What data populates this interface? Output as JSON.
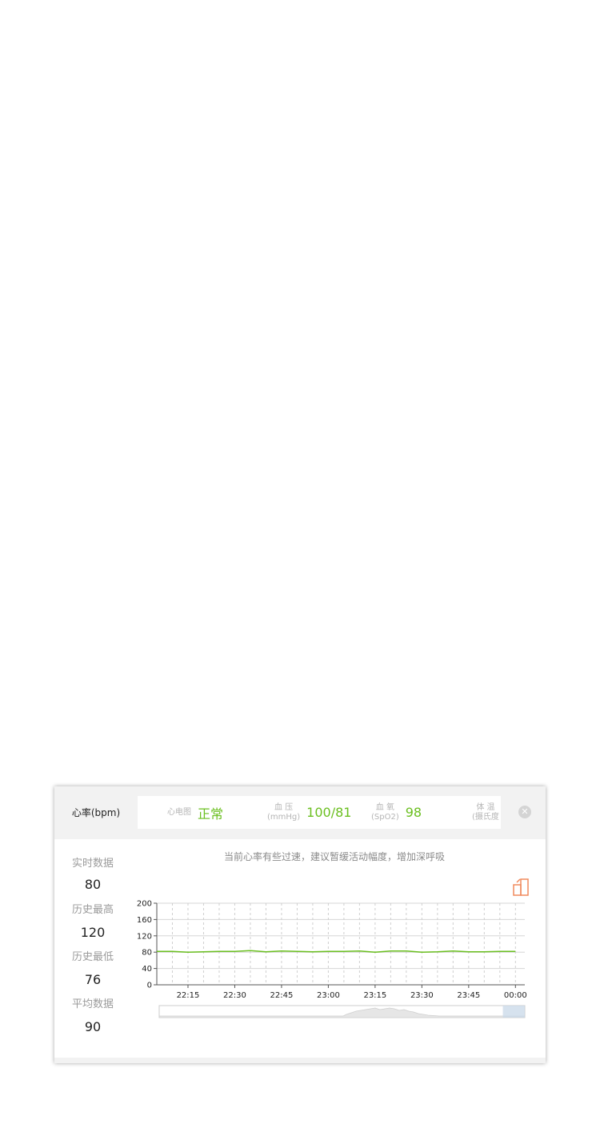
{
  "header": {
    "active_tab": "心率(bpm)",
    "metrics": [
      {
        "label_line1": "心电图",
        "label_line2": "",
        "value": "正常"
      },
      {
        "label_line1": "血 压",
        "label_line2": "(mmHg)",
        "value": "100/81"
      },
      {
        "label_line1": "血 氧",
        "label_line2": "(SpO2)",
        "value": "98"
      },
      {
        "label_line1": "体 温",
        "label_line2": "(摄氏度",
        "value": ""
      }
    ],
    "close_icon": "close-icon"
  },
  "stats": [
    {
      "label": "实时数据",
      "value": "80"
    },
    {
      "label": "历史最高",
      "value": "120"
    },
    {
      "label": "历史最低",
      "value": "76"
    },
    {
      "label": "平均数据",
      "value": "90"
    }
  ],
  "advice": "当前心率有些过速，建议暂缓活动幅度，增加深呼吸",
  "colors": {
    "accent_green": "#6abf1f",
    "export_icon": "#f08a5d"
  },
  "chart_data": {
    "type": "line",
    "ylim": [
      0,
      200
    ],
    "yticks": [
      0,
      40,
      80,
      120,
      160,
      200
    ],
    "xlabels": [
      "22:15",
      "22:30",
      "22:45",
      "23:00",
      "23:15",
      "23:30",
      "23:45",
      "00:00"
    ],
    "xlim_minutes": [
      0,
      118
    ],
    "series": [
      {
        "x": [
          0,
          5,
          10,
          15,
          20,
          25,
          30,
          35,
          40,
          45,
          50,
          55,
          60,
          65,
          70,
          75,
          80,
          85,
          90,
          95,
          100,
          105,
          110,
          115
        ],
        "values": [
          82,
          82,
          80,
          81,
          82,
          82,
          84,
          81,
          83,
          82,
          81,
          82,
          82,
          83,
          80,
          83,
          83,
          80,
          81,
          83,
          81,
          81,
          82,
          82
        ]
      }
    ],
    "grid": true,
    "minimap_window": [
      0.94,
      1.0
    ]
  }
}
